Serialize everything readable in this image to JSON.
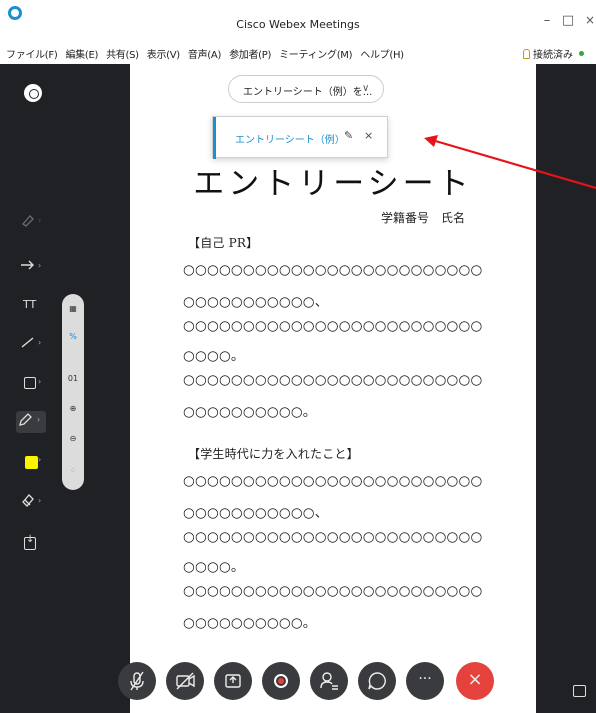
{
  "window": {
    "title": "Cisco Webex Meetings",
    "minimize_glyph": "–",
    "maximize_glyph": "□",
    "close_glyph": "×"
  },
  "menu": {
    "items": [
      {
        "label": "ファイル(F)"
      },
      {
        "label": "編集(E)"
      },
      {
        "label": "共有(S)"
      },
      {
        "label": "表示(V)"
      },
      {
        "label": "音声(A)"
      },
      {
        "label": "参加者(P)"
      },
      {
        "label": "ミーティング(M)"
      },
      {
        "label": "ヘルプ(H)"
      }
    ],
    "connection_status": "接続済み",
    "connection_color": "#2faa3e"
  },
  "share": {
    "document_selector_label": "エントリーシート（例）を...",
    "dropdown_item_label": "エントリーシート（例）",
    "edit_glyph": "✎",
    "close_glyph": "×"
  },
  "tools": {
    "icons": [
      "eraser-icon",
      "arrow-pointer-icon",
      "text-tool-icon",
      "line-tool-icon",
      "shape-tool-icon",
      "pen-tool-icon",
      "color-picker-icon",
      "rubber-eraser-icon",
      "save-icon"
    ],
    "text_label": "TT",
    "selected_color": "#fff200",
    "zoom_level": "01"
  },
  "document": {
    "title": "エントリーシート",
    "subtitle": "学籍番号　氏名",
    "section1_heading": "【自己 PR】",
    "section1_lines": [
      "○○○○○○○○○○○○○○○○○○○○○○○○○",
      "○○○○○○○○○○○、",
      "○○○○○○○○○○○○○○○○○○○○○○○○○",
      "○○○○。",
      "○○○○○○○○○○○○○○○○○○○○○○○○○",
      "○○○○○○○○○○。"
    ],
    "section2_heading": "【学生時代に力を入れたこと】",
    "section2_lines": [
      "○○○○○○○○○○○○○○○○○○○○○○○○○",
      "○○○○○○○○○○○、",
      "○○○○○○○○○○○○○○○○○○○○○○○○○",
      "○○○○。",
      "○○○○○○○○○○○○○○○○○○○○○○○○○",
      "○○○○○○○○○○。"
    ]
  },
  "controls": {
    "buttons": [
      "mute-icon",
      "video-icon",
      "share-icon",
      "record-icon",
      "participants-icon",
      "chat-icon",
      "more-icon",
      "end-call-icon"
    ],
    "more_glyph": "···",
    "end_glyph": "×"
  },
  "colors": {
    "dark_panel": "#202124",
    "accent_blue": "#1a8fd1",
    "end_red": "#e6423d",
    "annotation_red": "#e8131a"
  }
}
